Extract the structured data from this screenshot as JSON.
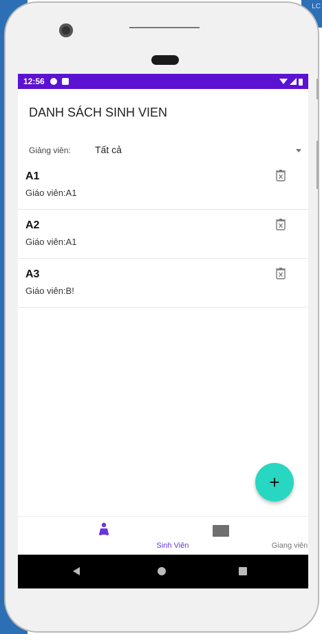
{
  "status_bar": {
    "time": "12:56"
  },
  "page": {
    "title": "DANH SÁCH SINH VIEN"
  },
  "filter": {
    "label": "Giảng viên:",
    "value": "Tất cả"
  },
  "students": [
    {
      "name": "A1",
      "teacher": "Giáo viên:A1"
    },
    {
      "name": "A2",
      "teacher": "Giáo viên:A1"
    },
    {
      "name": "A3",
      "teacher": "Giáo viên:B!"
    }
  ],
  "fab": {
    "label": "+"
  },
  "bottom_nav": {
    "tabs": [
      {
        "label": "Sinh Viên",
        "icon": "person-group-icon",
        "active": true
      },
      {
        "label": "Giang viên",
        "icon": "board-icon",
        "active": false
      }
    ]
  },
  "colors": {
    "status_bar": "#5b12d1",
    "fab": "#27d7c1",
    "active_tab": "#6a35d9",
    "background_window": "#2c6fb5"
  },
  "window_edge": {
    "text": "LC"
  }
}
